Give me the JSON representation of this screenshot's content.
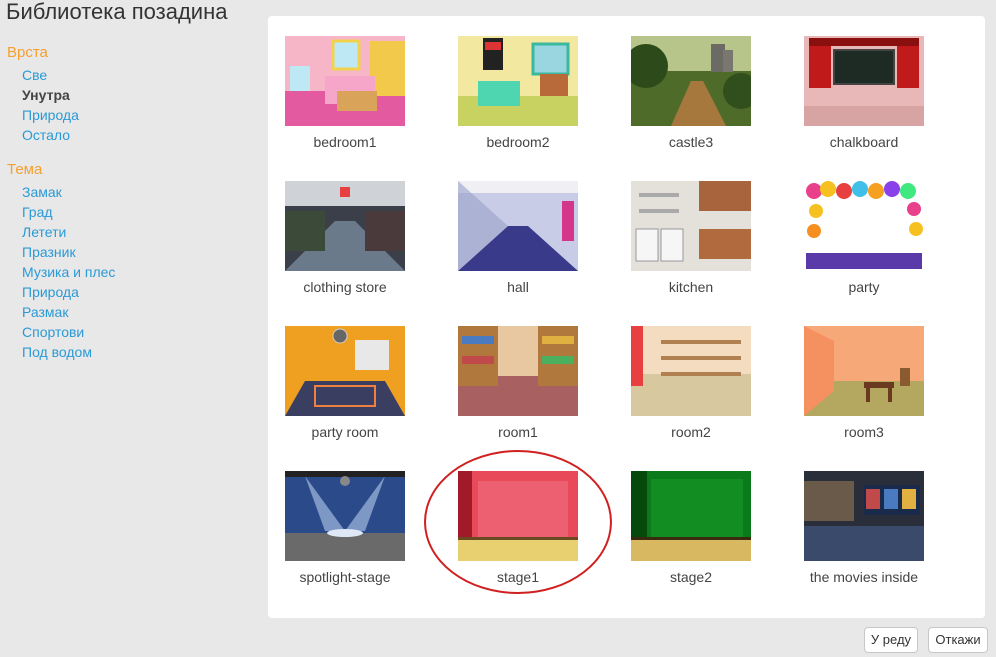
{
  "window": {
    "title": "Библиотека позадина"
  },
  "sidebar": {
    "type_heading": "Врста",
    "type_items": [
      "Све",
      "Унутра",
      "Природа",
      "Остало"
    ],
    "type_selected": "Унутра",
    "theme_heading": "Тема",
    "theme_items": [
      "Замак",
      "Град",
      "Летети",
      "Празник",
      "Музика и плес",
      "Природа",
      "Размак",
      "Спортови",
      "Под водом"
    ]
  },
  "backdrops": [
    {
      "name": "bedroom1",
      "icon": "bedroom-scene-thumbnail"
    },
    {
      "name": "bedroom2",
      "icon": "bedroom-scene-thumbnail"
    },
    {
      "name": "castle3",
      "icon": "forest-castle-thumbnail"
    },
    {
      "name": "chalkboard",
      "icon": "classroom-chalkboard-thumbnail"
    },
    {
      "name": "clothing store",
      "icon": "clothing-store-thumbnail"
    },
    {
      "name": "hall",
      "icon": "hallway-thumbnail"
    },
    {
      "name": "kitchen",
      "icon": "kitchen-thumbnail"
    },
    {
      "name": "party",
      "icon": "balloons-thumbnail"
    },
    {
      "name": "party room",
      "icon": "disco-room-thumbnail"
    },
    {
      "name": "room1",
      "icon": "bookshelf-room-thumbnail"
    },
    {
      "name": "room2",
      "icon": "shelf-room-thumbnail"
    },
    {
      "name": "room3",
      "icon": "orange-room-thumbnail"
    },
    {
      "name": "spotlight-stage",
      "icon": "spotlight-stage-thumbnail"
    },
    {
      "name": "stage1",
      "icon": "red-curtain-stage-thumbnail"
    },
    {
      "name": "stage2",
      "icon": "green-curtain-stage-thumbnail"
    },
    {
      "name": "the movies inside",
      "icon": "cinema-lobby-thumbnail"
    }
  ],
  "highlighted_backdrop": "stage1",
  "colors": {
    "accent_orange": "#f5a032",
    "link_blue": "#2a9ad6",
    "highlight_red": "#d02020"
  },
  "footer": {
    "ok_label": "У реду",
    "cancel_label": "Откажи"
  }
}
